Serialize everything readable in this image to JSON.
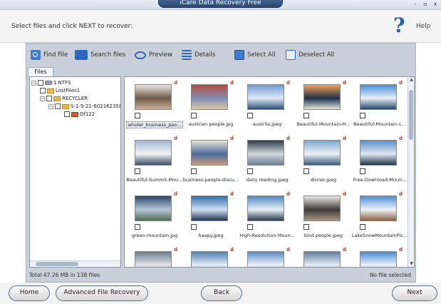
{
  "window": {
    "title": "iCare Data Recovery Free",
    "controls": [
      "-",
      "▫",
      "x"
    ]
  },
  "header": {
    "instruction": "Select files and click NEXT to recover:",
    "help_label": "Help",
    "help_symbol": "?"
  },
  "toolbar": {
    "find_file": "Find File",
    "search_files": "Search files",
    "preview": "Preview",
    "details": "Details",
    "select_all": "Select All",
    "deselect_all": "Deselect All"
  },
  "tab_files": "Files",
  "tree": {
    "items": [
      {
        "label": "1 NTFS",
        "expander": "−"
      },
      {
        "label": "LostFiles1",
        "expander": ""
      },
      {
        "label": "RECYCLER",
        "expander": "−"
      },
      {
        "label": "S-1-5-21-602162358-",
        "expander": "−"
      },
      {
        "label": "Df122",
        "expander": ""
      }
    ]
  },
  "thumbnails": [
    {
      "name": "wholer_business_peo...",
      "colors": [
        "#e8e6e0",
        "#6f5a4b",
        "#c7b09a"
      ]
    },
    {
      "name": "austrian people.jpg",
      "colors": [
        "#b64b3e",
        "#7e8fb5",
        "#d9c3a3"
      ]
    },
    {
      "name": "austrila.jpeg",
      "colors": [
        "#6f9ad6",
        "#dde8f3",
        "#2f4e7c"
      ]
    },
    {
      "name": "Beautiful-Mountain-H...",
      "colors": [
        "#f3a15a",
        "#1d2f4b",
        "#e7e3da"
      ]
    },
    {
      "name": "Beautiful-Mountain-L...",
      "colors": [
        "#4a8fd8",
        "#e9eef5",
        "#27466a"
      ]
    },
    {
      "name": "Beautiful-Summit-Mou...",
      "colors": [
        "#9fb9d6",
        "#f2f2f2",
        "#3c4e66"
      ]
    },
    {
      "name": "business-people-discu...",
      "colors": [
        "#e9e3d6",
        "#4d6b9e",
        "#c79d7f"
      ]
    },
    {
      "name": "daily reading.jpeg",
      "colors": [
        "#2f3c48",
        "#d1d6dc",
        "#6a7d8f"
      ]
    },
    {
      "name": "dinner.jpeg",
      "colors": [
        "#7fa5cf",
        "#edf1f6",
        "#3c5a80"
      ]
    },
    {
      "name": "Free-Download-Moun...",
      "colors": [
        "#5b8fc9",
        "#dfe7f0",
        "#22344c"
      ]
    },
    {
      "name": "green-mountain.jpg",
      "colors": [
        "#2c4763",
        "#b4c7dc",
        "#4f6f52"
      ]
    },
    {
      "name": "haapy.jpeg",
      "colors": [
        "#2f6eb1",
        "#cfe0f1",
        "#1f3552"
      ]
    },
    {
      "name": "High-Resolution-Moun...",
      "colors": [
        "#4e86c2",
        "#e7eef6",
        "#2b3b4f"
      ]
    },
    {
      "name": "kind people.jpeg",
      "colors": [
        "#ebeae6",
        "#3e3a37",
        "#a59484"
      ]
    },
    {
      "name": "LakeSnowMountainPic...",
      "colors": [
        "#4d8dd6",
        "#f0f3f7",
        "#8a5f42"
      ]
    },
    {
      "name": "",
      "colors": [
        "#6d7d8d",
        "#e3e6ea",
        "#333333"
      ]
    },
    {
      "name": "",
      "colors": [
        "#4f7fb5",
        "#e6edf5",
        "#243d5c"
      ]
    },
    {
      "name": "",
      "colors": [
        "#5c8cc5",
        "#eef2f7",
        "#2a3f5a"
      ]
    },
    {
      "name": "",
      "colors": [
        "#5f7fa4",
        "#e8edf3",
        "#2e3e52"
      ]
    },
    {
      "name": "",
      "colors": [
        "#4a89d1",
        "#eef3f8",
        "#2a4569"
      ]
    }
  ],
  "delete_marker": "d",
  "status": {
    "total": "Total 47.26 MB in 138 files",
    "selection": "No file selected"
  },
  "buttons": {
    "home": "Home",
    "advanced": "Advanced File Recovery",
    "back": "Back",
    "next": "Next"
  }
}
